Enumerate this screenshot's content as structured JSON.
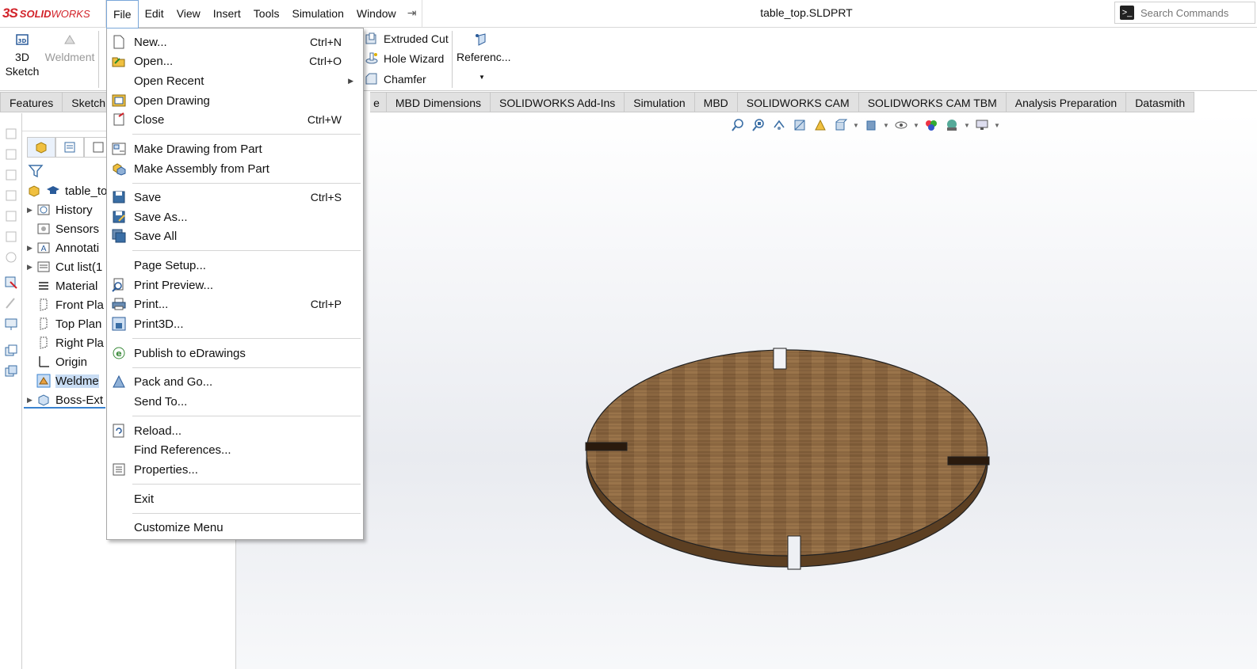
{
  "app": {
    "brand_ds": "3S",
    "brand_solid": "SOLID",
    "brand_works": "WORKS"
  },
  "menubar": {
    "items": [
      "File",
      "Edit",
      "View",
      "Insert",
      "Tools",
      "Simulation",
      "Window"
    ]
  },
  "document": {
    "title": "table_top.SLDPRT"
  },
  "search": {
    "placeholder": "Search Commands"
  },
  "ribbon": {
    "sketch3d_line1": "3D",
    "sketch3d_line2": "Sketch",
    "weldment": "Weldment",
    "extruded_cut": "Extruded Cut",
    "hole_wizard": "Hole Wizard",
    "chamfer": "Chamfer",
    "reference": "Referenc..."
  },
  "command_tabs": [
    "Features",
    "Sketch",
    "e",
    "MBD Dimensions",
    "SOLIDWORKS Add-Ins",
    "Simulation",
    "MBD",
    "SOLIDWORKS CAM",
    "SOLIDWORKS CAM TBM",
    "Analysis Preparation",
    "Datasmith"
  ],
  "tree": {
    "root": "table_to",
    "items": [
      "History",
      "Sensors",
      "Annotati",
      "Cut list(1",
      "Material",
      "Front Pla",
      "Top Plan",
      "Right Pla",
      "Origin",
      "Weldme",
      "Boss-Ext"
    ]
  },
  "file_menu": {
    "items": [
      {
        "label": "New...",
        "shortcut": "Ctrl+N"
      },
      {
        "label": "Open...",
        "shortcut": "Ctrl+O"
      },
      {
        "label": "Open Recent",
        "shortcut": ""
      },
      {
        "label": "Open Drawing",
        "shortcut": ""
      },
      {
        "label": "Close",
        "shortcut": "Ctrl+W"
      },
      {
        "label": "Make Drawing from Part",
        "shortcut": ""
      },
      {
        "label": "Make Assembly from Part",
        "shortcut": ""
      },
      {
        "label": "Save",
        "shortcut": "Ctrl+S"
      },
      {
        "label": "Save As...",
        "shortcut": ""
      },
      {
        "label": "Save All",
        "shortcut": ""
      },
      {
        "label": "Page Setup...",
        "shortcut": ""
      },
      {
        "label": "Print Preview...",
        "shortcut": ""
      },
      {
        "label": "Print...",
        "shortcut": "Ctrl+P"
      },
      {
        "label": "Print3D...",
        "shortcut": ""
      },
      {
        "label": "Publish to eDrawings",
        "shortcut": ""
      },
      {
        "label": "Pack and Go...",
        "shortcut": ""
      },
      {
        "label": "Send To...",
        "shortcut": ""
      },
      {
        "label": "Reload...",
        "shortcut": ""
      },
      {
        "label": "Find References...",
        "shortcut": ""
      },
      {
        "label": "Properties...",
        "shortcut": ""
      },
      {
        "label": "Exit",
        "shortcut": ""
      },
      {
        "label": "Customize Menu",
        "shortcut": ""
      }
    ]
  },
  "colors": {
    "brand_red": "#d2232a",
    "selection_blue": "#3a83d0",
    "wood": "#8a6640"
  }
}
